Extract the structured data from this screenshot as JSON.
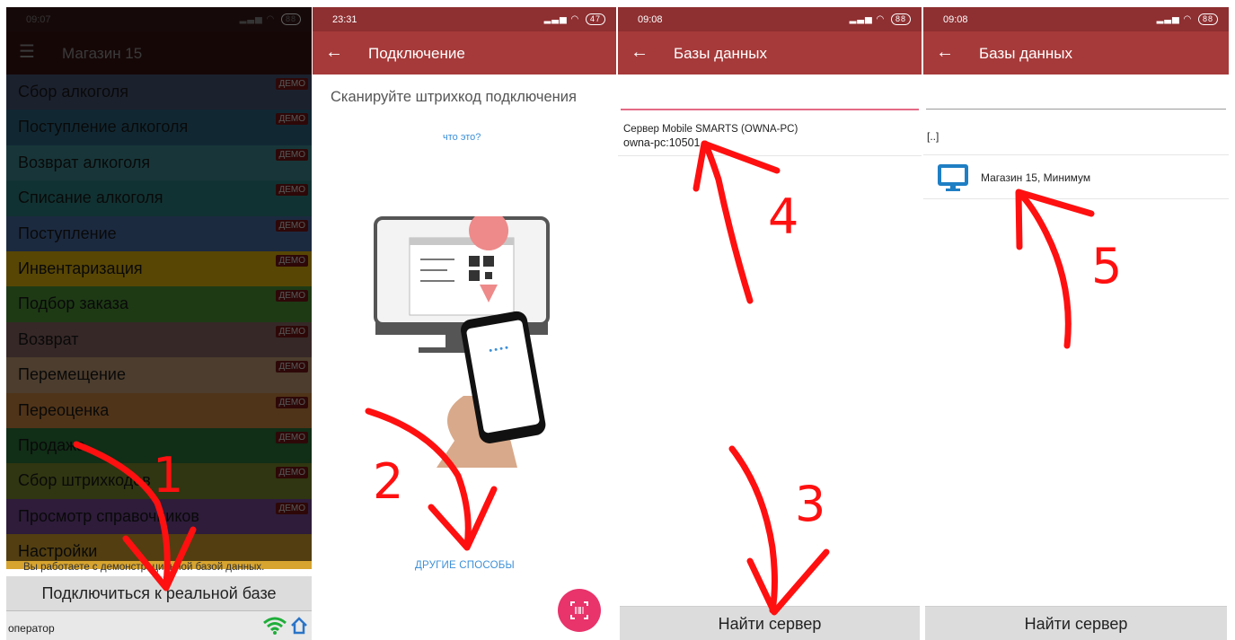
{
  "panel1": {
    "status_time": "09:07",
    "battery": "88",
    "app_title": "Магазин 15",
    "menu": [
      {
        "label": "Сбор алкоголя",
        "color": "#4a587a"
      },
      {
        "label": "Поступление алкоголя",
        "color": "#2f6a86"
      },
      {
        "label": "Возврат алкоголя",
        "color": "#3f8f95"
      },
      {
        "label": "Списание алкоголя",
        "color": "#2d8585"
      },
      {
        "label": "Поступление",
        "color": "#4a70a8"
      },
      {
        "label": "Инвентаризация",
        "color": "#e6b80d"
      },
      {
        "label": "Подбор заказа",
        "color": "#4f9a38"
      },
      {
        "label": "Возврат",
        "color": "#8e6a68"
      },
      {
        "label": "Перемещение",
        "color": "#c9a07a"
      },
      {
        "label": "Переоценка",
        "color": "#d18a42"
      },
      {
        "label": "Продажа",
        "color": "#2f7a3e"
      },
      {
        "label": "Сбор штрихкодов",
        "color": "#7f8f2d"
      },
      {
        "label": "Просмотр справочников",
        "color": "#7a4a99"
      },
      {
        "label": "Настройки",
        "color": "#d7a42f"
      }
    ],
    "demo_badge": "ДЕМО",
    "notice": "Вы работаете с демонстрационной базой данных.",
    "connect_button": "Подключиться к реальной базе",
    "operator": "оператор",
    "wifi_icon_color": "#1fae3a",
    "home_icon_color": "#2a74c8"
  },
  "panel2": {
    "status_time": "23:31",
    "battery": "47",
    "app_title": "Подключение",
    "scan_title": "Сканируйте штрихкод подключения",
    "what_link": "что это?",
    "other_link": "ДРУГИЕ СПОСОБЫ",
    "fab_color": "#e8336b",
    "fab_icon": "barcode-scan-icon"
  },
  "panel3": {
    "status_time": "09:08",
    "battery": "88",
    "app_title": "Базы данных",
    "server_name": "Сервер Mobile SMARTS (OWNA-PC)",
    "server_address": "owna-pc:10501",
    "find_button": "Найти сервер"
  },
  "panel4": {
    "status_time": "09:08",
    "battery": "88",
    "app_title": "Базы данных",
    "parent_entry": "[..]",
    "database_name": "Магазин 15, Минимум",
    "find_button": "Найти сервер"
  },
  "annotations": {
    "numbers": [
      "1",
      "2",
      "3",
      "4",
      "5"
    ],
    "arrow_color": "#ff1010"
  },
  "accent_colors": {
    "appbar": "#a63a3a",
    "statusbar": "#8e2f31",
    "link": "#3d90d8",
    "input_focus": "#e46b86"
  }
}
